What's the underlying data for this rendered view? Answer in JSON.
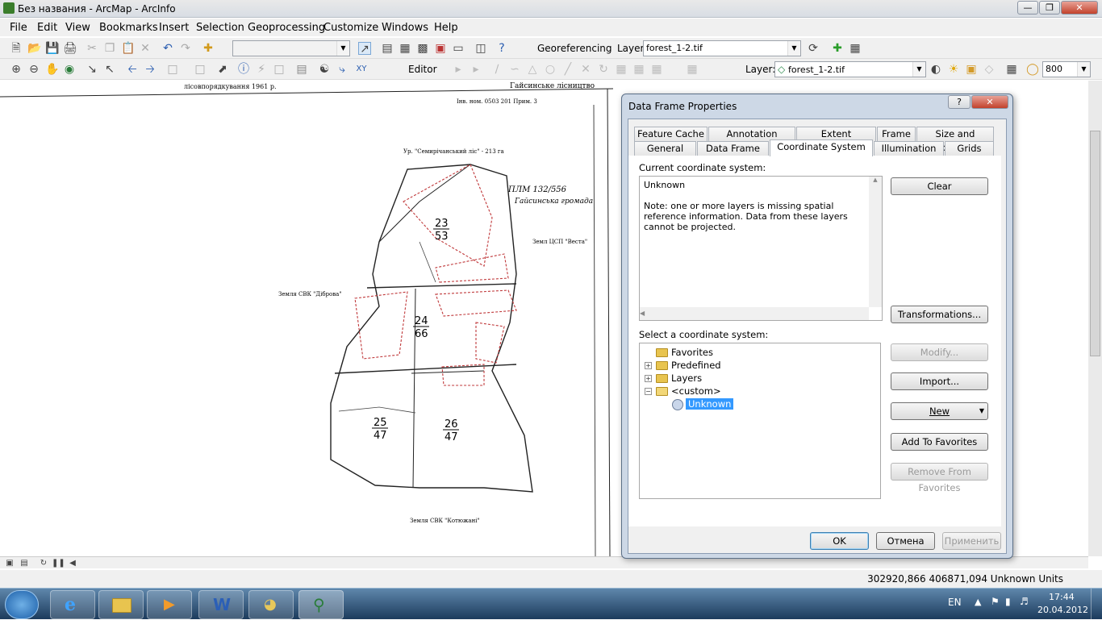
{
  "window": {
    "title": "Без названия - ArcMap - ArcInfo"
  },
  "menu": [
    "File",
    "Edit",
    "View",
    "Bookmarks",
    "Insert",
    "Selection",
    "Geoprocessing",
    "Customize",
    "Windows",
    "Help"
  ],
  "toolbar1": {
    "georef_label": "Georeferencing",
    "layer_label": "Layer:",
    "layer_value": "forest_1-2.tif"
  },
  "toolbar2": {
    "editor_label": "Editor",
    "layer_label": "Layer:",
    "layer_value": "forest_1-2.tif",
    "scale_value": "800"
  },
  "map": {
    "header_left": "лісовпорядкування 1961 р.",
    "header_right": "Гайсинське лісництво",
    "ref": "Інв. ном. 0503 201 Прим. 3",
    "north_label": "Ур. \"Семирічанський ліс\" - 213 га",
    "annot1": "ПЛМ 132/556",
    "annot2": "Гайсинська громада",
    "west_label": "Земля СВК \"Діброва\"",
    "east_label": "Земл ЦСП \"Веста\"",
    "south_label": "Земля СВК \"Котюжанi\"",
    "blocks": [
      {
        "num": "23",
        "area": "53"
      },
      {
        "num": "24",
        "area": "66"
      },
      {
        "num": "25",
        "area": "47"
      },
      {
        "num": "26",
        "area": "47"
      }
    ]
  },
  "dialog": {
    "title": "Data Frame Properties",
    "tabs_row1": [
      "Feature Cache",
      "Annotation Groups",
      "Extent Indicators",
      "Frame",
      "Size and Position"
    ],
    "tabs_row2": [
      "General",
      "Data Frame",
      "Coordinate System",
      "Illumination",
      "Grids"
    ],
    "current_label": "Current coordinate system:",
    "current_value": "Unknown",
    "note": "Note: one or more layers is missing spatial reference information.  Data from these layers cannot be projected.",
    "select_label": "Select a coordinate system:",
    "tree": [
      "Favorites",
      "Predefined",
      "Layers",
      "<custom>",
      "Unknown"
    ],
    "buttons": {
      "clear": "Clear",
      "transformations": "Transformations...",
      "modify": "Modify...",
      "import": "Import...",
      "new": "New",
      "add_fav": "Add To Favorites",
      "remove_fav": "Remove From Favorites"
    },
    "footer": {
      "ok": "OK",
      "cancel": "Отмена",
      "apply": "Применить"
    }
  },
  "status": {
    "coords": "302920,866  406871,094 Unknown Units"
  },
  "taskbar": {
    "lang": "EN",
    "time": "17:44",
    "date": "20.04.2012"
  }
}
